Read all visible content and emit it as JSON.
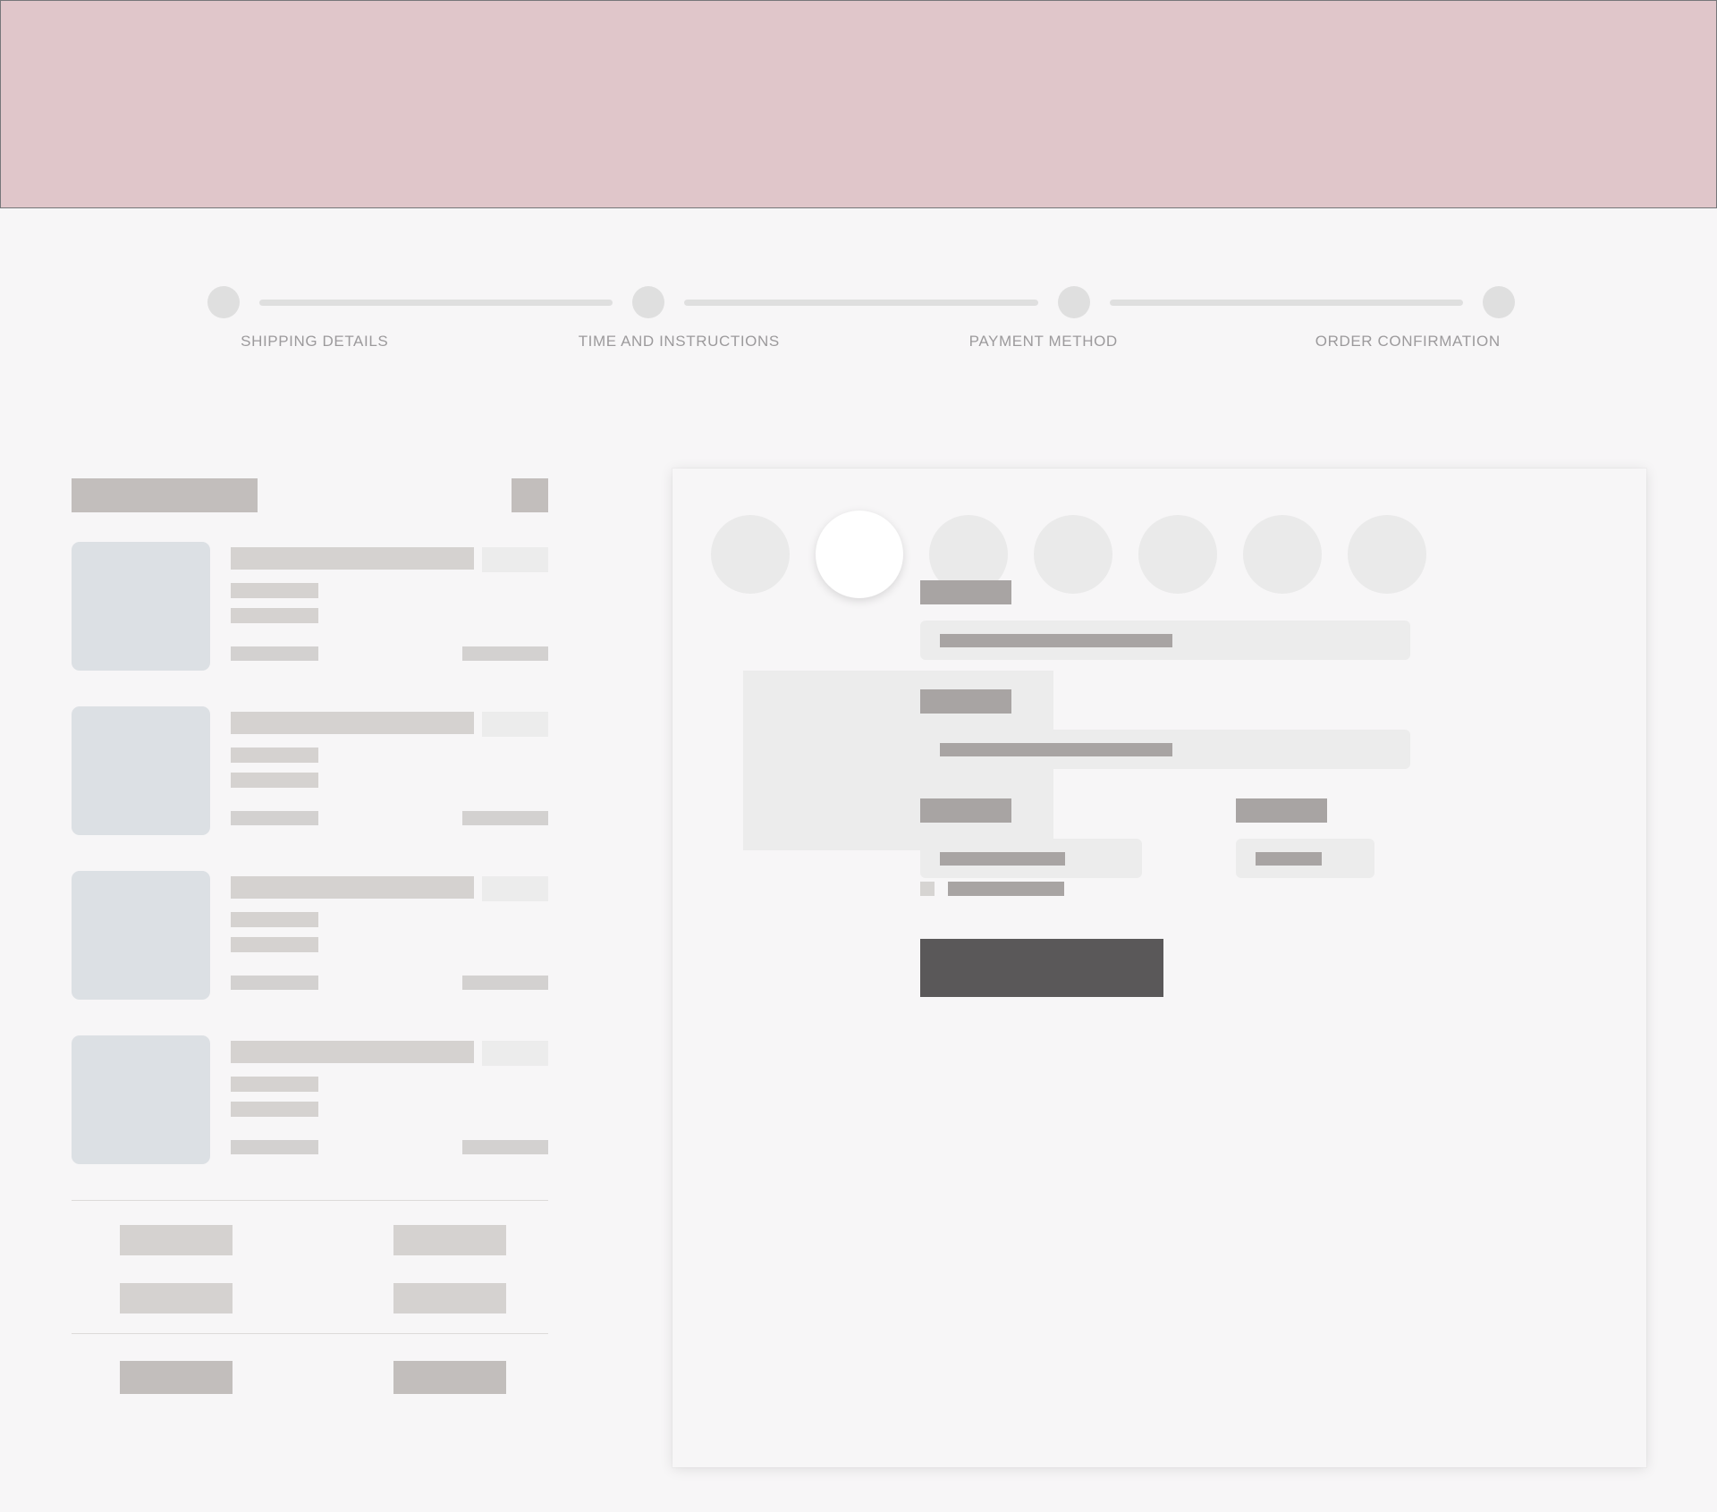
{
  "page": {
    "title": "Checkout — Loading Skeleton",
    "background_color": "#F7F6F7"
  },
  "top_banner": {
    "name": "promo-banner",
    "fill_color": "#E0C6CA",
    "border_color": "#76777A",
    "label": ""
  },
  "stepper": {
    "name": "checkout-progress-stepper",
    "active_step_index": 0,
    "dot_color": "#DFDFDF",
    "line_color": "#DFDFDF",
    "label_color": "#9C9A9C",
    "steps": [
      {
        "label": "SHIPPING DETAILS"
      },
      {
        "label": "TIME AND INSTRUCTIONS"
      },
      {
        "label": "PAYMENT METHOD"
      },
      {
        "label": "ORDER CONFIRMATION"
      }
    ]
  },
  "order_summary": {
    "name": "order-summary-panel",
    "title_placeholder": "",
    "count_placeholder": "",
    "items": [
      {
        "name_placeholder": "",
        "price_placeholder": "",
        "meta1_placeholder": "",
        "meta2_placeholder": "",
        "qty_placeholder": "",
        "line_total_placeholder": ""
      },
      {
        "name_placeholder": "",
        "price_placeholder": "",
        "meta1_placeholder": "",
        "meta2_placeholder": "",
        "qty_placeholder": "",
        "line_total_placeholder": ""
      },
      {
        "name_placeholder": "",
        "price_placeholder": "",
        "meta1_placeholder": "",
        "meta2_placeholder": "",
        "qty_placeholder": "",
        "line_total_placeholder": ""
      },
      {
        "name_placeholder": "",
        "price_placeholder": "",
        "meta1_placeholder": "",
        "meta2_placeholder": "",
        "qty_placeholder": "",
        "line_total_placeholder": ""
      }
    ],
    "totals": [
      {
        "label_placeholder": "",
        "value_placeholder": ""
      },
      {
        "label_placeholder": "",
        "value_placeholder": ""
      }
    ],
    "grand_total": {
      "label_placeholder": "",
      "value_placeholder": ""
    },
    "thumbnail_color": "#DCE0E4",
    "skeleton_color": "#D5D2D0",
    "heading_color": "#C2BEBC"
  },
  "payment_card": {
    "name": "payment-method-card",
    "background_color": "#F7F6F7",
    "avatars": [
      {
        "state": "idle"
      },
      {
        "state": "selected"
      },
      {
        "state": "idle"
      },
      {
        "state": "idle"
      },
      {
        "state": "idle"
      },
      {
        "state": "idle"
      },
      {
        "state": "idle"
      }
    ],
    "preview_image_placeholder": "",
    "fields": [
      {
        "label_placeholder": "",
        "value_placeholder": ""
      },
      {
        "label_placeholder": "",
        "value_placeholder": ""
      }
    ],
    "field_row": [
      {
        "label_placeholder": "",
        "value_placeholder": ""
      },
      {
        "label_placeholder": "",
        "value_placeholder": ""
      }
    ],
    "checkbox": {
      "checked": false,
      "label_placeholder": ""
    },
    "submit_button": {
      "label_placeholder": "",
      "color": "#5A5859"
    }
  }
}
